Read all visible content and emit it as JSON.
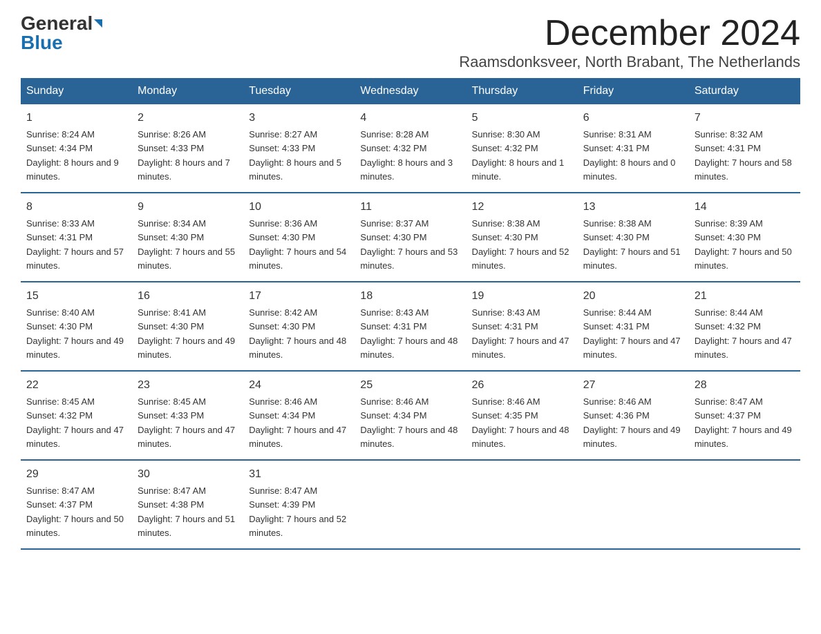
{
  "header": {
    "logo_general": "General",
    "logo_blue": "Blue",
    "month_title": "December 2024",
    "location": "Raamsdonksveer, North Brabant, The Netherlands"
  },
  "days_of_week": [
    "Sunday",
    "Monday",
    "Tuesday",
    "Wednesday",
    "Thursday",
    "Friday",
    "Saturday"
  ],
  "weeks": [
    [
      {
        "day": "1",
        "sunrise": "8:24 AM",
        "sunset": "4:34 PM",
        "daylight": "8 hours and 9 minutes."
      },
      {
        "day": "2",
        "sunrise": "8:26 AM",
        "sunset": "4:33 PM",
        "daylight": "8 hours and 7 minutes."
      },
      {
        "day": "3",
        "sunrise": "8:27 AM",
        "sunset": "4:33 PM",
        "daylight": "8 hours and 5 minutes."
      },
      {
        "day": "4",
        "sunrise": "8:28 AM",
        "sunset": "4:32 PM",
        "daylight": "8 hours and 3 minutes."
      },
      {
        "day": "5",
        "sunrise": "8:30 AM",
        "sunset": "4:32 PM",
        "daylight": "8 hours and 1 minute."
      },
      {
        "day": "6",
        "sunrise": "8:31 AM",
        "sunset": "4:31 PM",
        "daylight": "8 hours and 0 minutes."
      },
      {
        "day": "7",
        "sunrise": "8:32 AM",
        "sunset": "4:31 PM",
        "daylight": "7 hours and 58 minutes."
      }
    ],
    [
      {
        "day": "8",
        "sunrise": "8:33 AM",
        "sunset": "4:31 PM",
        "daylight": "7 hours and 57 minutes."
      },
      {
        "day": "9",
        "sunrise": "8:34 AM",
        "sunset": "4:30 PM",
        "daylight": "7 hours and 55 minutes."
      },
      {
        "day": "10",
        "sunrise": "8:36 AM",
        "sunset": "4:30 PM",
        "daylight": "7 hours and 54 minutes."
      },
      {
        "day": "11",
        "sunrise": "8:37 AM",
        "sunset": "4:30 PM",
        "daylight": "7 hours and 53 minutes."
      },
      {
        "day": "12",
        "sunrise": "8:38 AM",
        "sunset": "4:30 PM",
        "daylight": "7 hours and 52 minutes."
      },
      {
        "day": "13",
        "sunrise": "8:38 AM",
        "sunset": "4:30 PM",
        "daylight": "7 hours and 51 minutes."
      },
      {
        "day": "14",
        "sunrise": "8:39 AM",
        "sunset": "4:30 PM",
        "daylight": "7 hours and 50 minutes."
      }
    ],
    [
      {
        "day": "15",
        "sunrise": "8:40 AM",
        "sunset": "4:30 PM",
        "daylight": "7 hours and 49 minutes."
      },
      {
        "day": "16",
        "sunrise": "8:41 AM",
        "sunset": "4:30 PM",
        "daylight": "7 hours and 49 minutes."
      },
      {
        "day": "17",
        "sunrise": "8:42 AM",
        "sunset": "4:30 PM",
        "daylight": "7 hours and 48 minutes."
      },
      {
        "day": "18",
        "sunrise": "8:43 AM",
        "sunset": "4:31 PM",
        "daylight": "7 hours and 48 minutes."
      },
      {
        "day": "19",
        "sunrise": "8:43 AM",
        "sunset": "4:31 PM",
        "daylight": "7 hours and 47 minutes."
      },
      {
        "day": "20",
        "sunrise": "8:44 AM",
        "sunset": "4:31 PM",
        "daylight": "7 hours and 47 minutes."
      },
      {
        "day": "21",
        "sunrise": "8:44 AM",
        "sunset": "4:32 PM",
        "daylight": "7 hours and 47 minutes."
      }
    ],
    [
      {
        "day": "22",
        "sunrise": "8:45 AM",
        "sunset": "4:32 PM",
        "daylight": "7 hours and 47 minutes."
      },
      {
        "day": "23",
        "sunrise": "8:45 AM",
        "sunset": "4:33 PM",
        "daylight": "7 hours and 47 minutes."
      },
      {
        "day": "24",
        "sunrise": "8:46 AM",
        "sunset": "4:34 PM",
        "daylight": "7 hours and 47 minutes."
      },
      {
        "day": "25",
        "sunrise": "8:46 AM",
        "sunset": "4:34 PM",
        "daylight": "7 hours and 48 minutes."
      },
      {
        "day": "26",
        "sunrise": "8:46 AM",
        "sunset": "4:35 PM",
        "daylight": "7 hours and 48 minutes."
      },
      {
        "day": "27",
        "sunrise": "8:46 AM",
        "sunset": "4:36 PM",
        "daylight": "7 hours and 49 minutes."
      },
      {
        "day": "28",
        "sunrise": "8:47 AM",
        "sunset": "4:37 PM",
        "daylight": "7 hours and 49 minutes."
      }
    ],
    [
      {
        "day": "29",
        "sunrise": "8:47 AM",
        "sunset": "4:37 PM",
        "daylight": "7 hours and 50 minutes."
      },
      {
        "day": "30",
        "sunrise": "8:47 AM",
        "sunset": "4:38 PM",
        "daylight": "7 hours and 51 minutes."
      },
      {
        "day": "31",
        "sunrise": "8:47 AM",
        "sunset": "4:39 PM",
        "daylight": "7 hours and 52 minutes."
      },
      null,
      null,
      null,
      null
    ]
  ],
  "labels": {
    "sunrise": "Sunrise:",
    "sunset": "Sunset:",
    "daylight": "Daylight:"
  }
}
